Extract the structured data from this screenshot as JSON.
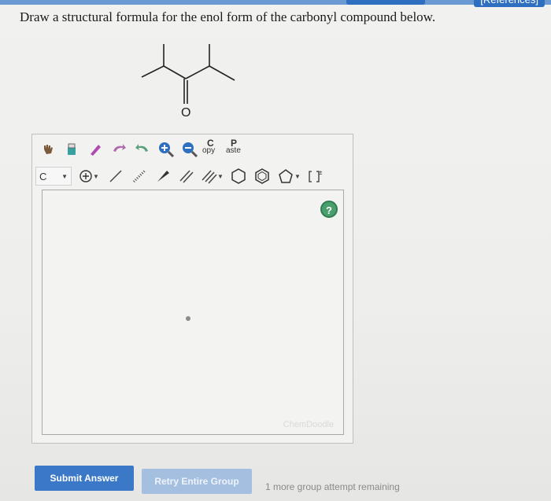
{
  "header": {
    "references_label": "[References]"
  },
  "question": {
    "text": "Draw a structural formula for the enol form of the carbonyl compound below."
  },
  "molecule": {
    "atom_label": "O"
  },
  "toolbar": {
    "row1": {
      "icons": [
        "hand-icon",
        "eraser-icon",
        "pencil-icon",
        "rotate-left-icon",
        "rotate-right-icon",
        "zoom-in-icon",
        "zoom-out-icon"
      ],
      "copy": {
        "big": "C",
        "small": "opy"
      },
      "paste": {
        "big": "P",
        "small": "aste"
      }
    },
    "row2": {
      "element_value": "C",
      "icons": [
        "charge-plus-icon",
        "single-bond-icon",
        "hashed-bond-icon",
        "wedge-bond-icon",
        "double-bond-icon",
        "triple-bond-icon",
        "hexagon-icon",
        "benzene-icon",
        "pentagon-icon",
        "bracket-charge-icon"
      ]
    }
  },
  "canvas": {
    "help_label": "?",
    "watermark": "ChemDoodle"
  },
  "actions": {
    "submit_label": "Submit Answer",
    "retry_label": "Retry Entire Group",
    "remaining_text": "1 more group attempt remaining"
  },
  "colors": {
    "accent": "#3b78c8",
    "help": "#4aa06d",
    "disabled": "#a5bfe0"
  }
}
